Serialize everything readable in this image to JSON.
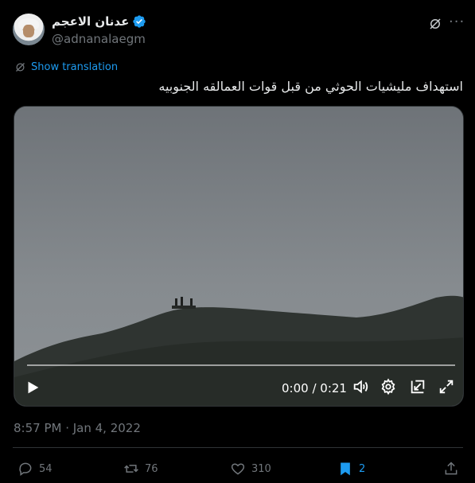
{
  "author": {
    "name": "عدنان الاعجم",
    "handle": "@adnanalaegm",
    "verified": true
  },
  "translate_label": "Show translation",
  "tweet_text": "استهداف مليشيات الحوثي  من قبل قوات العمالقه الجنوبيه",
  "video": {
    "time_display": "0:00 / 0:21",
    "progress": 0
  },
  "timestamp": "8:57 PM · Jan 4, 2022",
  "actions": {
    "replies": "54",
    "reposts": "76",
    "likes": "310",
    "bookmarks": "2"
  },
  "colors": {
    "accent": "#1d9bf0",
    "muted": "#71767b",
    "background": "#000000"
  }
}
